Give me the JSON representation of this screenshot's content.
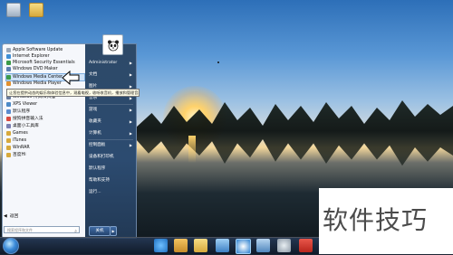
{
  "desktop": {
    "icons": [
      {
        "name": "recycle-bin-icon",
        "label": ""
      },
      {
        "name": "folder-icon",
        "label": ""
      }
    ]
  },
  "start_menu": {
    "programs": [
      {
        "label": "Apple Software Update",
        "color": "#9aa7b8"
      },
      {
        "label": "Internet Explorer",
        "color": "#3f8fd6"
      },
      {
        "label": "Microsoft Security Essentials",
        "color": "#3a9a48"
      },
      {
        "label": "Windows DVD Maker",
        "color": "#5d7fb0"
      },
      {
        "label": "Windows Media Center",
        "color": "#3d9b4a"
      },
      {
        "label": "Windows Media Player",
        "color": "#e2902f"
      },
      {
        "label": "Windows 传真和扫描",
        "color": "#6a7ea0"
      },
      {
        "label": "XPS Viewer",
        "color": "#4c8ac7"
      },
      {
        "label": "默认程序",
        "color": "#5a8ccf"
      },
      {
        "label": "搜狗拼音输入法",
        "color": "#d94a3f"
      },
      {
        "label": "桌面小工具库",
        "color": "#7a7fb2"
      },
      {
        "label": "Games",
        "color": "#d7a93c"
      },
      {
        "label": "iTunes",
        "color": "#d7a93c"
      },
      {
        "label": "WinRAR",
        "color": "#d7a93c"
      },
      {
        "label": "百度Hi",
        "color": "#d7a93c"
      }
    ],
    "highlighted_index": 4,
    "tooltip": "让您在提供动态的娱乐和体验信息中，观看电视，收听收音机，播放和管理音乐，图片，视频和录像。",
    "back_label": "返回",
    "search_placeholder": "搜索程序和文件",
    "right_items": [
      "Administrator",
      "文档",
      "图片",
      "音乐",
      "游戏",
      "收藏夹",
      "计算机",
      "控制面板",
      "设备和打印机",
      "默认程序",
      "帮助和支持",
      "运行..."
    ],
    "shutdown_label": "关机"
  },
  "watermark": {
    "text": "软件技巧"
  }
}
